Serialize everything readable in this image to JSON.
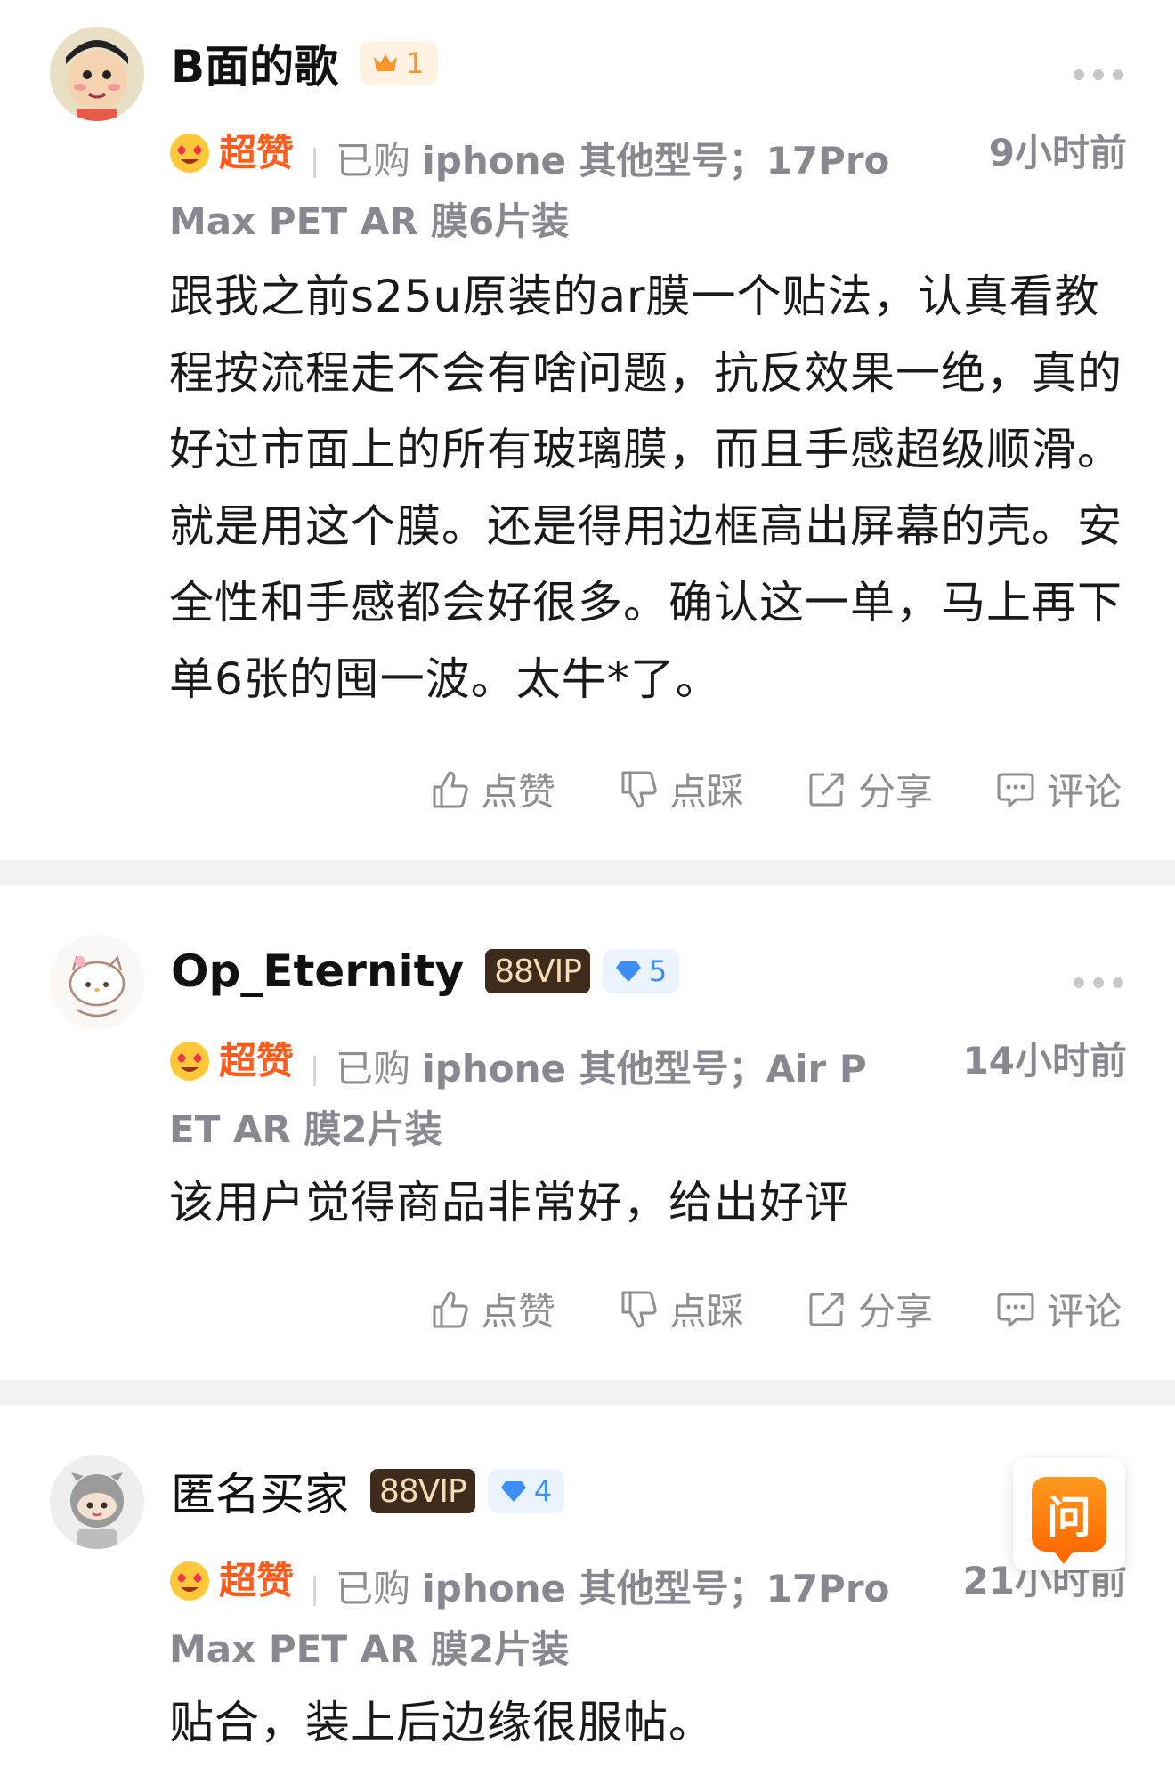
{
  "reviews": [
    {
      "username": "B面的歌",
      "crown_level": "1",
      "rating_label": "超赞",
      "purchase_label": "已购",
      "spec_line1": "iphone 其他型号；17Pro",
      "spec_line2": "Max PET AR 膜6片装",
      "time": "9小时前",
      "content": "跟我之前s25u原装的ar膜一个贴法，认真看教程按流程走不会有啥问题，抗反效果一绝，真的好过市面上的所有玻璃膜，而且手感超级顺滑。就是用这个膜。还是得用边框高出屏幕的壳。安全性和手感都会好很多。确认这一单，马上再下单6张的囤一波。太牛*了。"
    },
    {
      "username": "Op_Eternity",
      "vip_label": "88VIP",
      "diamond_level": "5",
      "rating_label": "超赞",
      "purchase_label": "已购",
      "spec_line1": "iphone 其他型号；Air P",
      "spec_line2": "ET AR 膜2片装",
      "time": "14小时前",
      "content": "该用户觉得商品非常好，给出好评"
    },
    {
      "username": "匿名买家",
      "vip_label": "88VIP",
      "diamond_level": "4",
      "rating_label": "超赞",
      "purchase_label": "已购",
      "spec_line1": "iphone 其他型号；17Pro",
      "spec_line2": "Max PET AR 膜2片装",
      "time": "21小时前",
      "content": "贴合，装上后边缘很服帖。"
    }
  ],
  "actions": {
    "like": "点赞",
    "dislike": "点踩",
    "share": "分享",
    "comment": "评论"
  },
  "ask_button": "问",
  "colors": {
    "rating": "#ff5b1a",
    "crown_badge": "#f7952b",
    "diamond_badge": "#3d8ef5",
    "vip_badge_bg": "#3f2b1c",
    "ask_button": "#ff7a0a"
  },
  "icons": [
    "crown-icon",
    "diamond-icon",
    "heart-eyes-icon",
    "thumb-up-icon",
    "thumb-down-icon",
    "share-icon",
    "comment-icon",
    "more-icon"
  ]
}
